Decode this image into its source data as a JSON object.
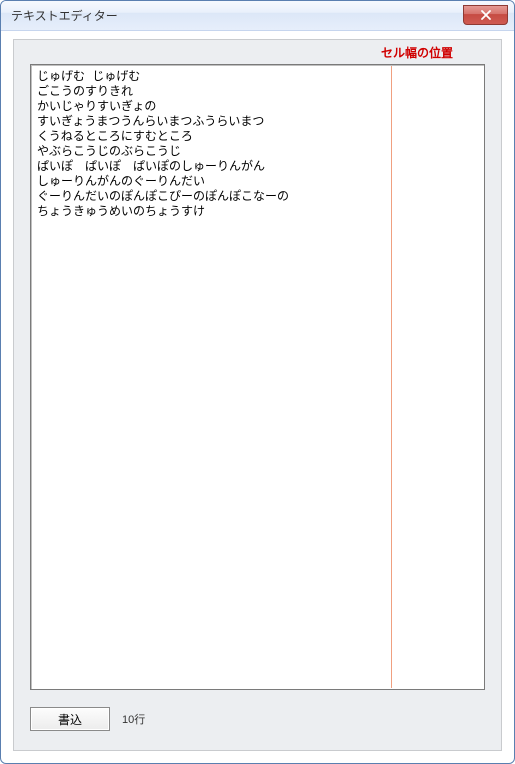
{
  "window": {
    "title": "テキストエディター"
  },
  "ruler": {
    "label": "セル幅の位置"
  },
  "editor": {
    "lines": [
      "じゅげむ じゅげむ",
      "ごこうのすりきれ",
      "かいじゃりすいぎょの",
      "すいぎょうまつうんらいまつふうらいまつ",
      "くうねるところにすむところ",
      "やぶらこうじのぶらこうじ",
      "ぱいぽ　ぱいぽ　ぱいぽのしゅーりんがん",
      "しゅーりんがんのぐーりんだい",
      "ぐーりんだいのぽんぽこぴーのぽんぽこなーの",
      "ちょうきゅうめいのちょうすけ"
    ]
  },
  "footer": {
    "write_button": "書込",
    "line_count_label": "10行"
  }
}
